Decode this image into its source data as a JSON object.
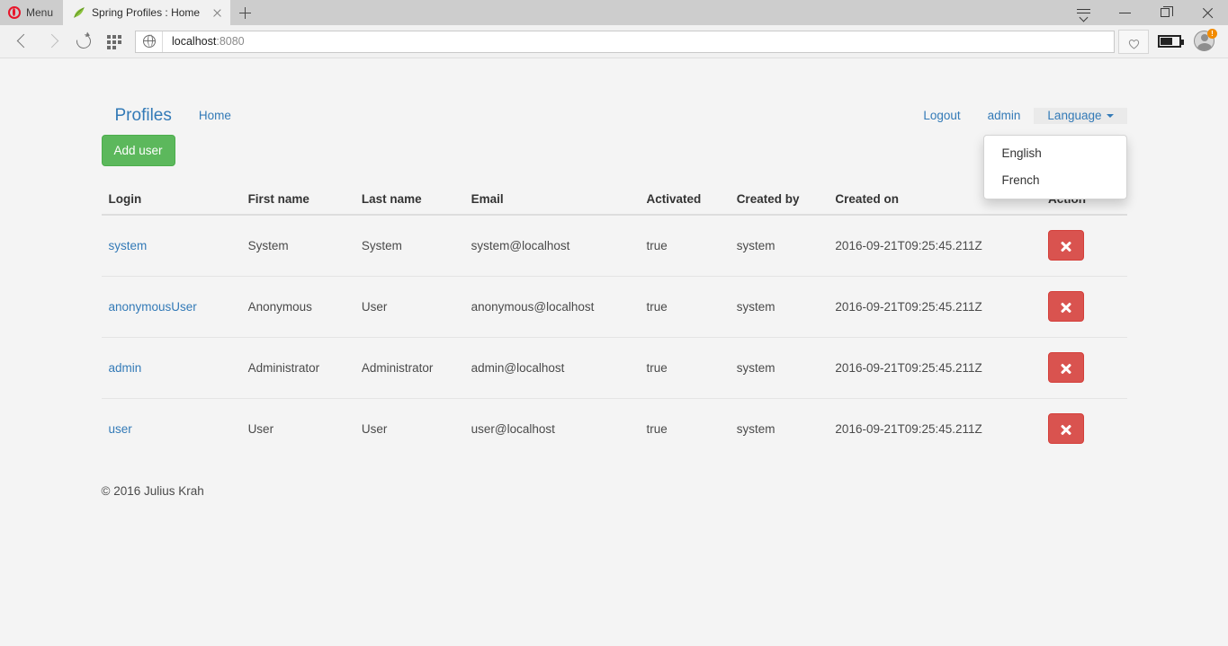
{
  "browser": {
    "menu_label": "Menu",
    "tab": {
      "title": "Spring Profiles : Home",
      "favicon": "spring-leaf-icon",
      "close": "close-icon"
    },
    "new_tab": "+",
    "address": {
      "host": "localhost",
      "port": ":8080",
      "full": "localhost:8080"
    },
    "window_controls": {
      "tab_menu": "tab-menu-icon",
      "minimize": "minimize-icon",
      "maximize": "maximize-icon",
      "close": "close-icon"
    },
    "toolbar_icons": {
      "back": "back-arrow-icon",
      "forward": "forward-arrow-icon",
      "reload": "reload-icon",
      "speed_dial": "speed-dial-grid-icon",
      "site_info": "globe-icon",
      "bookmark": "heart-icon",
      "battery": "battery-icon",
      "profile": "profile-avatar-icon",
      "profile_badge": "!"
    }
  },
  "navbar": {
    "brand": "Profiles",
    "left_links": [
      {
        "label": "Home",
        "name": "nav-link-home"
      }
    ],
    "right_links": [
      {
        "label": "Logout",
        "name": "nav-link-logout"
      },
      {
        "label": "admin",
        "name": "nav-link-admin"
      }
    ],
    "language": {
      "label": "Language",
      "open": true,
      "options": [
        {
          "label": "English",
          "name": "dropdown-item-english"
        },
        {
          "label": "French",
          "name": "dropdown-item-french"
        }
      ]
    }
  },
  "actions": {
    "add_user": "Add user"
  },
  "table": {
    "columns": [
      "Login",
      "First name",
      "Last name",
      "Email",
      "Activated",
      "Created by",
      "Created on",
      "Action"
    ],
    "rows": [
      {
        "login": "system",
        "first_name": "System",
        "last_name": "System",
        "email": "system@localhost",
        "activated": "true",
        "created_by": "system",
        "created_on": "2016-09-21T09:25:45.211Z",
        "action": "delete-icon"
      },
      {
        "login": "anonymousUser",
        "first_name": "Anonymous",
        "last_name": "User",
        "email": "anonymous@localhost",
        "activated": "true",
        "created_by": "system",
        "created_on": "2016-09-21T09:25:45.211Z",
        "action": "delete-icon"
      },
      {
        "login": "admin",
        "first_name": "Administrator",
        "last_name": "Administrator",
        "email": "admin@localhost",
        "activated": "true",
        "created_by": "system",
        "created_on": "2016-09-21T09:25:45.211Z",
        "action": "delete-icon"
      },
      {
        "login": "user",
        "first_name": "User",
        "last_name": "User",
        "email": "user@localhost",
        "activated": "true",
        "created_by": "system",
        "created_on": "2016-09-21T09:25:45.211Z",
        "action": "delete-icon"
      }
    ]
  },
  "footer": {
    "copyright": "© 2016 Julius Krah"
  },
  "colors": {
    "page_background": "#f4f4f4",
    "link": "#337ab7",
    "success_button": "#5cb85c",
    "danger_button": "#d9534f",
    "chrome_titlebar": "#cdcdcd",
    "chrome_toolbar": "#f1f1f1",
    "opera_red": "#e8152a"
  }
}
